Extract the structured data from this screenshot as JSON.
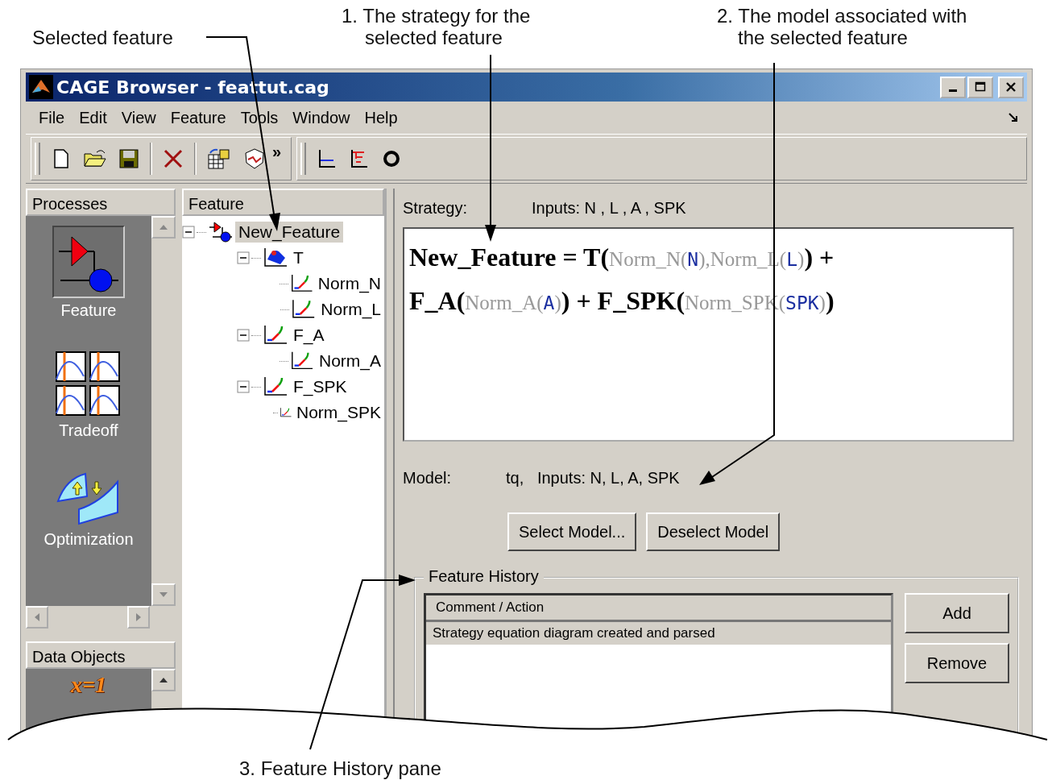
{
  "annotations": {
    "selected_feature": "Selected feature",
    "strategy": [
      "1. The strategy for the",
      "selected feature"
    ],
    "model": [
      "2. The model associated with",
      "the selected feature"
    ],
    "history": "3. Feature History pane"
  },
  "window": {
    "title": "CAGE Browser - feattut.cag"
  },
  "menu": [
    "File",
    "Edit",
    "View",
    "Feature",
    "Tools",
    "Window",
    "Help"
  ],
  "toolbar": {
    "overflow": "»"
  },
  "processes": {
    "title": "Processes",
    "items": [
      {
        "label": "Feature",
        "kind": "feature",
        "selected": true
      },
      {
        "label": "Tradeoff",
        "kind": "tradeoff",
        "selected": false
      },
      {
        "label": "Optimization",
        "kind": "optimization",
        "selected": false
      }
    ]
  },
  "data_objects": {
    "title": "Data Objects",
    "icon_text": "x=1"
  },
  "feature_tree": {
    "title": "Feature",
    "items": [
      {
        "label": "New_Feature",
        "kind": "feature",
        "selected": true,
        "expanded": true,
        "children": [
          {
            "label": "T",
            "kind": "table",
            "selected": false,
            "expanded": true,
            "children": [
              {
                "label": "Norm_N",
                "kind": "curve",
                "selected": false
              },
              {
                "label": "Norm_L",
                "kind": "curve",
                "selected": false
              }
            ]
          },
          {
            "label": "F_A",
            "kind": "curve",
            "selected": false,
            "expanded": true,
            "children": [
              {
                "label": "Norm_A",
                "kind": "curve",
                "selected": false
              }
            ]
          },
          {
            "label": "F_SPK",
            "kind": "curve",
            "selected": false,
            "expanded": true,
            "children": [
              {
                "label": "Norm_SPK",
                "kind": "curve",
                "selected": false
              }
            ]
          }
        ]
      }
    ]
  },
  "strategy": {
    "label": "Strategy:",
    "inputs": "Inputs: N , L , A , SPK",
    "equation": [
      [
        {
          "text": "New_Feature = T(",
          "kind": "function"
        },
        {
          "text": "Norm_N(",
          "kind": "argument"
        },
        {
          "text": "N",
          "kind": "input"
        },
        {
          "text": "),Norm_L(",
          "kind": "argument"
        },
        {
          "text": "L",
          "kind": "input"
        },
        {
          "text": ")",
          "kind": "argument"
        },
        {
          "text": ") +",
          "kind": "function"
        }
      ],
      [
        {
          "text": "F_A(",
          "kind": "function"
        },
        {
          "text": "Norm_A(",
          "kind": "argument"
        },
        {
          "text": "A",
          "kind": "input"
        },
        {
          "text": ")",
          "kind": "argument"
        },
        {
          "text": ") + F_SPK(",
          "kind": "function"
        },
        {
          "text": "Norm_SPK(",
          "kind": "argument"
        },
        {
          "text": "SPK",
          "kind": "input"
        },
        {
          "text": ")",
          "kind": "argument"
        },
        {
          "text": ")",
          "kind": "function"
        }
      ]
    ]
  },
  "model": {
    "label": "Model:",
    "value": "tq,   Inputs: N, L, A, SPK"
  },
  "model_buttons": [
    "Select Model...",
    "Deselect Model"
  ],
  "feature_history": {
    "title": "Feature History",
    "column": "Comment / Action",
    "rows": [
      {
        "text": "Strategy equation diagram created and parsed",
        "selected": true
      }
    ],
    "buttons": [
      "Add",
      "Remove"
    ]
  }
}
